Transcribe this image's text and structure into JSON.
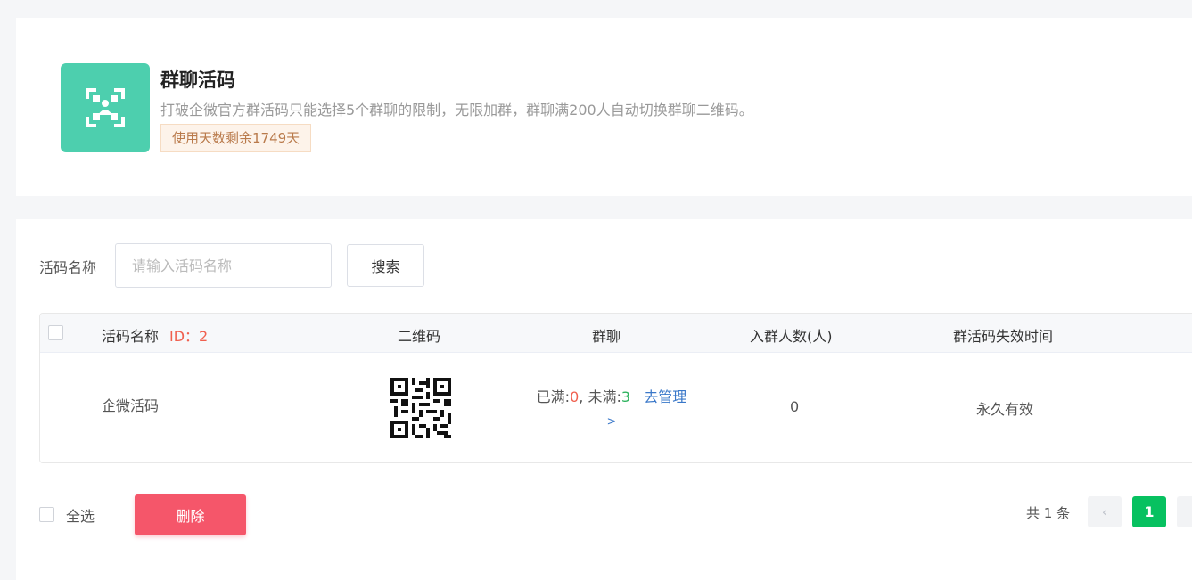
{
  "header": {
    "title": "群聊活码",
    "description": "打破企微官方群活码只能选择5个群聊的限制，无限加群，群聊满200人自动切换群聊二维码。",
    "days_remaining": "使用天数剩余1749天",
    "icon": "group-qrcode-icon",
    "icon_color": "#4dcfae"
  },
  "search": {
    "label": "活码名称",
    "placeholder": "请输入活码名称",
    "value": "",
    "button_label": "搜索"
  },
  "table": {
    "columns": {
      "name": "活码名称",
      "id_label": "ID：2",
      "qrcode": "二维码",
      "group": "群聊",
      "members": "入群人数(人)",
      "expire": "群活码失效时间"
    },
    "rows": [
      {
        "name": "企微活码",
        "full_label": "已满:",
        "full_count": "0",
        "separator": ", 未满:",
        "not_full_count": "3",
        "manage_link": "去管理",
        "manage_arrow": ">",
        "members": "0",
        "expire": "永久有效"
      }
    ]
  },
  "footer": {
    "select_all": "全选",
    "delete_label": "删除",
    "total": "共 1 条",
    "prev": "‹",
    "current_page": "1",
    "next": "›"
  },
  "colors": {
    "accent_green": "#07c160",
    "danger": "#f5566a",
    "link": "#3a78c9"
  }
}
